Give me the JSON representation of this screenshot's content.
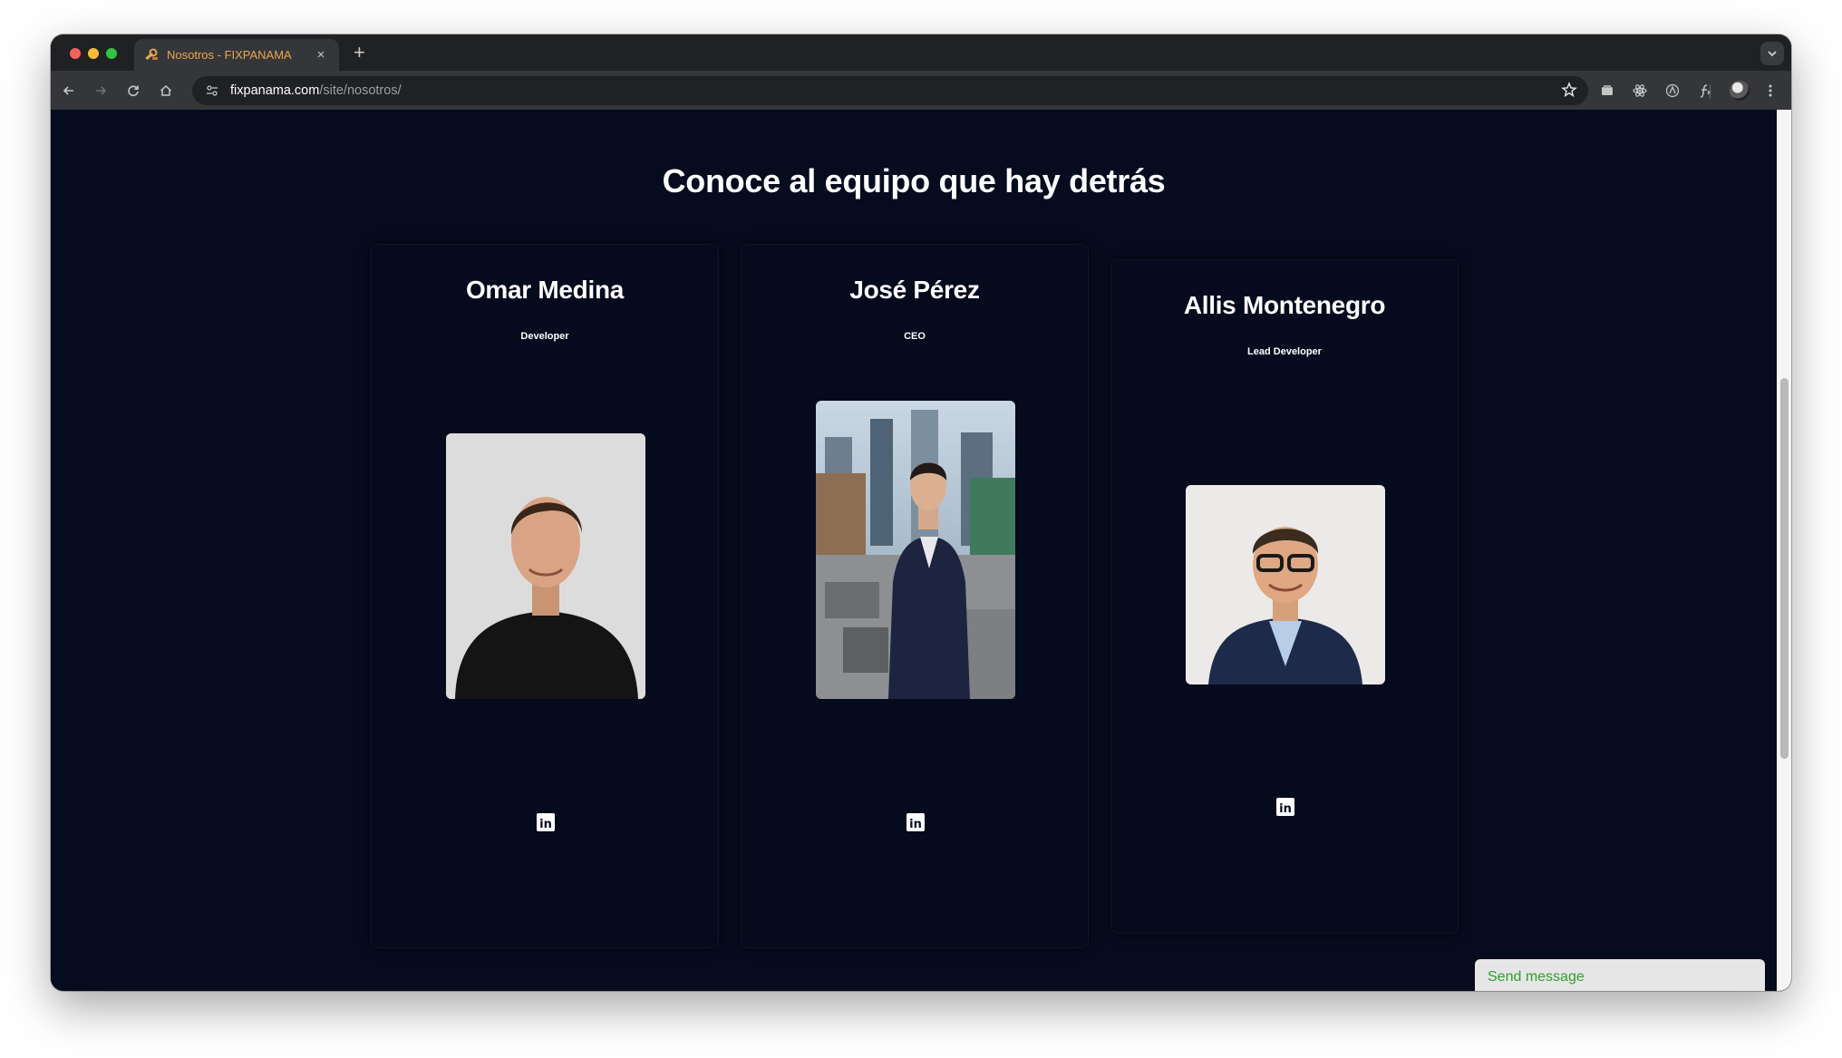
{
  "browser": {
    "tab_title": "Nosotros - FIXPANAMA",
    "url_host": "fixpanama.com",
    "url_path": "/site/nosotros/",
    "new_tab": "+",
    "close_tab": "×"
  },
  "page": {
    "heading": "Conoce al equipo que hay detrás",
    "team": [
      {
        "name": "Omar Medina",
        "role": "Developer"
      },
      {
        "name": "José Pérez",
        "role": "CEO"
      },
      {
        "name": "Allis Montenegro",
        "role": "Lead Developer"
      }
    ],
    "linkedin_glyph": "in"
  },
  "chat": {
    "send_label": "Send message"
  },
  "colors": {
    "page_background": "#060b1e",
    "chat_text": "#2f9e2f",
    "tab_title": "#e8a84c"
  }
}
